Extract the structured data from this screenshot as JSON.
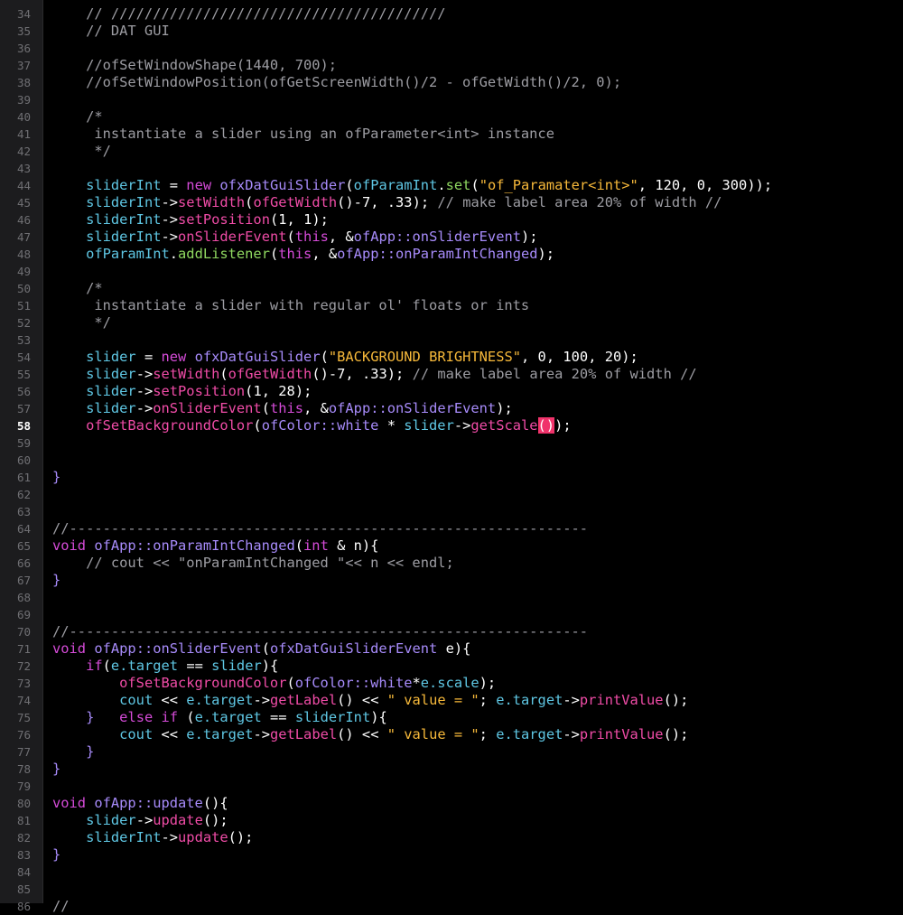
{
  "editor": {
    "colors": {
      "background": "#000000",
      "gutter": "#1c1c1e",
      "line_number": "#6f6f73",
      "comment": "#9d9da3",
      "keyword": "#d54bd8",
      "variable": "#5fc7e4",
      "method": "#f04ca7",
      "class": "#8fd860",
      "string": "#f7b93a",
      "cursor_highlight": "#f0336b"
    },
    "current_line": 58,
    "lines": [
      {
        "n": "34",
        "t": [
          [
            "c",
            "    // ////////////////////////////////////////"
          ]
        ]
      },
      {
        "n": "35",
        "t": [
          [
            "c",
            "    // DAT GUI"
          ]
        ]
      },
      {
        "n": "36",
        "t": []
      },
      {
        "n": "37",
        "t": [
          [
            "c",
            "    //ofSetWindowShape(1440, 700);"
          ]
        ]
      },
      {
        "n": "38",
        "t": [
          [
            "c",
            "    //ofSetWindowPosition(ofGetScreenWidth()/2 - ofGetWidth()/2, 0);"
          ]
        ]
      },
      {
        "n": "39",
        "t": []
      },
      {
        "n": "40",
        "t": [
          [
            "c",
            "    /*"
          ]
        ]
      },
      {
        "n": "41",
        "t": [
          [
            "c",
            "     instantiate a slider using an ofParameter<int> instance"
          ]
        ]
      },
      {
        "n": "42",
        "t": [
          [
            "c",
            "     */"
          ]
        ]
      },
      {
        "n": "43",
        "t": []
      },
      {
        "n": "44",
        "t": [
          [
            "pl",
            "    "
          ],
          [
            "pr",
            "sliderInt"
          ],
          [
            "pl",
            " = "
          ],
          [
            "k",
            "new"
          ],
          [
            "pl",
            " "
          ],
          [
            "pu",
            "ofxDatGuiSlider"
          ],
          [
            "pl",
            "("
          ],
          [
            "pr",
            "ofParamInt"
          ],
          [
            "pl",
            "."
          ],
          [
            "gr",
            "set"
          ],
          [
            "pl",
            "("
          ],
          [
            "st",
            "\"of_Paramater<int>\""
          ],
          [
            "pl",
            ", "
          ],
          [
            "nm",
            "120"
          ],
          [
            "pl",
            ", "
          ],
          [
            "nm",
            "0"
          ],
          [
            "pl",
            ", "
          ],
          [
            "nm",
            "300"
          ],
          [
            "pl",
            "));"
          ]
        ]
      },
      {
        "n": "45",
        "t": [
          [
            "pl",
            "    "
          ],
          [
            "pr",
            "sliderInt"
          ],
          [
            "pl",
            "->"
          ],
          [
            "mg",
            "setWidth"
          ],
          [
            "pl",
            "("
          ],
          [
            "mg",
            "ofGetWidth"
          ],
          [
            "pl",
            "()-"
          ],
          [
            "nm",
            "7"
          ],
          [
            "pl",
            ", "
          ],
          [
            "nm",
            ".33"
          ],
          [
            "pl",
            ");"
          ],
          [
            "c",
            " // make label area 20% of width //"
          ]
        ]
      },
      {
        "n": "46",
        "t": [
          [
            "pl",
            "    "
          ],
          [
            "pr",
            "sliderInt"
          ],
          [
            "pl",
            "->"
          ],
          [
            "mg",
            "setPosition"
          ],
          [
            "pl",
            "("
          ],
          [
            "nm",
            "1"
          ],
          [
            "pl",
            ", "
          ],
          [
            "nm",
            "1"
          ],
          [
            "pl",
            ");"
          ]
        ]
      },
      {
        "n": "47",
        "t": [
          [
            "pl",
            "    "
          ],
          [
            "pr",
            "sliderInt"
          ],
          [
            "pl",
            "->"
          ],
          [
            "mg",
            "onSliderEvent"
          ],
          [
            "pl",
            "("
          ],
          [
            "k",
            "this"
          ],
          [
            "pl",
            ", &"
          ],
          [
            "pu",
            "ofApp::onSliderEvent"
          ],
          [
            "pl",
            ");"
          ]
        ]
      },
      {
        "n": "48",
        "t": [
          [
            "pl",
            "    "
          ],
          [
            "pr",
            "ofParamInt"
          ],
          [
            "pl",
            "."
          ],
          [
            "gr",
            "addListener"
          ],
          [
            "pl",
            "("
          ],
          [
            "k",
            "this"
          ],
          [
            "pl",
            ", &"
          ],
          [
            "pu",
            "ofApp::onParamIntChanged"
          ],
          [
            "pl",
            ");"
          ]
        ]
      },
      {
        "n": "49",
        "t": []
      },
      {
        "n": "50",
        "t": [
          [
            "c",
            "    /*"
          ]
        ]
      },
      {
        "n": "51",
        "t": [
          [
            "c",
            "     instantiate a slider with regular ol' floats or ints"
          ]
        ]
      },
      {
        "n": "52",
        "t": [
          [
            "c",
            "     */"
          ]
        ]
      },
      {
        "n": "53",
        "t": []
      },
      {
        "n": "54",
        "t": [
          [
            "pl",
            "    "
          ],
          [
            "pr",
            "slider"
          ],
          [
            "pl",
            " = "
          ],
          [
            "k",
            "new"
          ],
          [
            "pl",
            " "
          ],
          [
            "pu",
            "ofxDatGuiSlider"
          ],
          [
            "pl",
            "("
          ],
          [
            "st",
            "\"BACKGROUND BRIGHTNESS\""
          ],
          [
            "pl",
            ", "
          ],
          [
            "nm",
            "0"
          ],
          [
            "pl",
            ", "
          ],
          [
            "nm",
            "100"
          ],
          [
            "pl",
            ", "
          ],
          [
            "nm",
            "20"
          ],
          [
            "pl",
            ");"
          ]
        ]
      },
      {
        "n": "55",
        "t": [
          [
            "pl",
            "    "
          ],
          [
            "pr",
            "slider"
          ],
          [
            "pl",
            "->"
          ],
          [
            "mg",
            "setWidth"
          ],
          [
            "pl",
            "("
          ],
          [
            "mg",
            "ofGetWidth"
          ],
          [
            "pl",
            "()-"
          ],
          [
            "nm",
            "7"
          ],
          [
            "pl",
            ", "
          ],
          [
            "nm",
            ".33"
          ],
          [
            "pl",
            ");"
          ],
          [
            "c",
            " // make label area 20% of width //"
          ]
        ]
      },
      {
        "n": "56",
        "t": [
          [
            "pl",
            "    "
          ],
          [
            "pr",
            "slider"
          ],
          [
            "pl",
            "->"
          ],
          [
            "mg",
            "setPosition"
          ],
          [
            "pl",
            "("
          ],
          [
            "nm",
            "1"
          ],
          [
            "pl",
            ", "
          ],
          [
            "nm",
            "28"
          ],
          [
            "pl",
            ");"
          ]
        ]
      },
      {
        "n": "57",
        "t": [
          [
            "pl",
            "    "
          ],
          [
            "pr",
            "slider"
          ],
          [
            "pl",
            "->"
          ],
          [
            "mg",
            "onSliderEvent"
          ],
          [
            "pl",
            "("
          ],
          [
            "k",
            "this"
          ],
          [
            "pl",
            ", &"
          ],
          [
            "pu",
            "ofApp::onSliderEvent"
          ],
          [
            "pl",
            ");"
          ]
        ]
      },
      {
        "n": "58",
        "t": [
          [
            "pl",
            "    "
          ],
          [
            "mg",
            "ofSetBackgroundColor"
          ],
          [
            "pl",
            "("
          ],
          [
            "pu",
            "ofColor::white"
          ],
          [
            "pl",
            " * "
          ],
          [
            "pr",
            "slider"
          ],
          [
            "pl",
            "->"
          ],
          [
            "mg",
            "getScale"
          ],
          [
            "cur",
            "()"
          ],
          [
            "pl",
            ");"
          ]
        ]
      },
      {
        "n": "59",
        "t": []
      },
      {
        "n": "60",
        "t": []
      },
      {
        "n": "61",
        "t": [
          [
            "pu",
            "}"
          ]
        ]
      },
      {
        "n": "62",
        "t": []
      },
      {
        "n": "63",
        "t": []
      },
      {
        "n": "64",
        "t": [
          [
            "c",
            "//--------------------------------------------------------------"
          ]
        ]
      },
      {
        "n": "65",
        "t": [
          [
            "k",
            "void"
          ],
          [
            "pl",
            " "
          ],
          [
            "pu",
            "ofApp::onParamIntChanged"
          ],
          [
            "pl",
            "("
          ],
          [
            "k",
            "int"
          ],
          [
            "pl",
            " & n){"
          ]
        ]
      },
      {
        "n": "66",
        "t": [
          [
            "c",
            "    // cout << \"onParamIntChanged \"<< n << endl;"
          ]
        ]
      },
      {
        "n": "67",
        "t": [
          [
            "pu",
            "}"
          ]
        ]
      },
      {
        "n": "68",
        "t": []
      },
      {
        "n": "69",
        "t": []
      },
      {
        "n": "70",
        "t": [
          [
            "c",
            "//--------------------------------------------------------------"
          ]
        ]
      },
      {
        "n": "71",
        "t": [
          [
            "k",
            "void"
          ],
          [
            "pl",
            " "
          ],
          [
            "pu",
            "ofApp::onSliderEvent"
          ],
          [
            "pl",
            "("
          ],
          [
            "pu",
            "ofxDatGuiSliderEvent"
          ],
          [
            "pl",
            " e){"
          ]
        ]
      },
      {
        "n": "72",
        "t": [
          [
            "pl",
            "    "
          ],
          [
            "k",
            "if"
          ],
          [
            "pl",
            "("
          ],
          [
            "pr",
            "e.target"
          ],
          [
            "pl",
            " == "
          ],
          [
            "pr",
            "slider"
          ],
          [
            "pl",
            "){"
          ]
        ]
      },
      {
        "n": "73",
        "t": [
          [
            "pl",
            "        "
          ],
          [
            "mg",
            "ofSetBackgroundColor"
          ],
          [
            "pl",
            "("
          ],
          [
            "pu",
            "ofColor::white"
          ],
          [
            "pl",
            "*"
          ],
          [
            "pr",
            "e.scale"
          ],
          [
            "pl",
            ");"
          ]
        ]
      },
      {
        "n": "74",
        "t": [
          [
            "pl",
            "        "
          ],
          [
            "pr",
            "cout"
          ],
          [
            "pl",
            " << "
          ],
          [
            "pr",
            "e.target"
          ],
          [
            "pl",
            "->"
          ],
          [
            "mg",
            "getLabel"
          ],
          [
            "pl",
            "() << "
          ],
          [
            "st",
            "\" value = \""
          ],
          [
            "pl",
            "; "
          ],
          [
            "pr",
            "e.target"
          ],
          [
            "pl",
            "->"
          ],
          [
            "mg",
            "printValue"
          ],
          [
            "pl",
            "();"
          ]
        ]
      },
      {
        "n": "75",
        "t": [
          [
            "pl",
            "    "
          ],
          [
            "pu",
            "}"
          ],
          [
            "pl",
            "   "
          ],
          [
            "k",
            "else if"
          ],
          [
            "pl",
            " ("
          ],
          [
            "pr",
            "e.target"
          ],
          [
            "pl",
            " == "
          ],
          [
            "pr",
            "sliderInt"
          ],
          [
            "pl",
            "){"
          ]
        ]
      },
      {
        "n": "76",
        "t": [
          [
            "pl",
            "        "
          ],
          [
            "pr",
            "cout"
          ],
          [
            "pl",
            " << "
          ],
          [
            "pr",
            "e.target"
          ],
          [
            "pl",
            "->"
          ],
          [
            "mg",
            "getLabel"
          ],
          [
            "pl",
            "() << "
          ],
          [
            "st",
            "\" value = \""
          ],
          [
            "pl",
            "; "
          ],
          [
            "pr",
            "e.target"
          ],
          [
            "pl",
            "->"
          ],
          [
            "mg",
            "printValue"
          ],
          [
            "pl",
            "();"
          ]
        ]
      },
      {
        "n": "77",
        "t": [
          [
            "pl",
            "    "
          ],
          [
            "pu",
            "}"
          ]
        ]
      },
      {
        "n": "78",
        "t": [
          [
            "pu",
            "}"
          ]
        ]
      },
      {
        "n": "79",
        "t": []
      },
      {
        "n": "80",
        "t": [
          [
            "k",
            "void"
          ],
          [
            "pl",
            " "
          ],
          [
            "pu",
            "ofApp::update"
          ],
          [
            "pl",
            "(){"
          ]
        ]
      },
      {
        "n": "81",
        "t": [
          [
            "pl",
            "    "
          ],
          [
            "pr",
            "slider"
          ],
          [
            "pl",
            "->"
          ],
          [
            "mg",
            "update"
          ],
          [
            "pl",
            "();"
          ]
        ]
      },
      {
        "n": "82",
        "t": [
          [
            "pl",
            "    "
          ],
          [
            "pr",
            "sliderInt"
          ],
          [
            "pl",
            "->"
          ],
          [
            "mg",
            "update"
          ],
          [
            "pl",
            "();"
          ]
        ]
      },
      {
        "n": "83",
        "t": [
          [
            "pu",
            "}"
          ]
        ]
      },
      {
        "n": "84",
        "t": []
      },
      {
        "n": "85",
        "t": []
      },
      {
        "n": "86",
        "t": [
          [
            "c",
            "//"
          ]
        ]
      }
    ]
  }
}
